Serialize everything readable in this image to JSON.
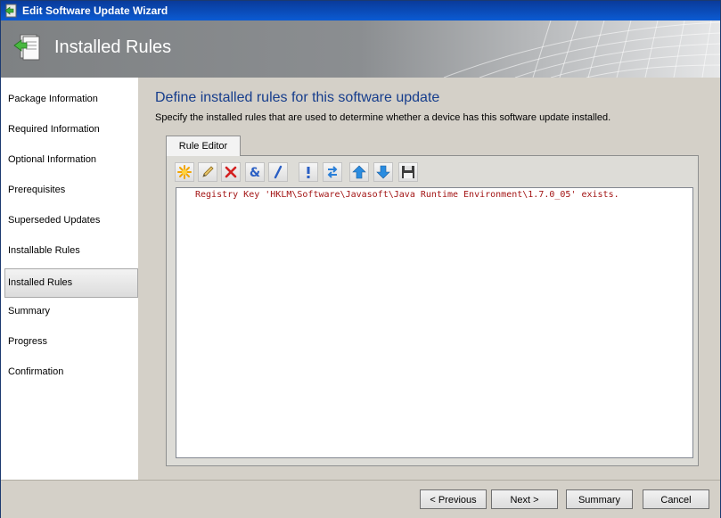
{
  "window": {
    "title": "Edit Software Update Wizard"
  },
  "banner": {
    "title": "Installed Rules"
  },
  "sidebar": {
    "items": [
      {
        "label": "Package Information",
        "active": false
      },
      {
        "label": "Required Information",
        "active": false
      },
      {
        "label": "Optional Information",
        "active": false
      },
      {
        "label": "Prerequisites",
        "active": false
      },
      {
        "label": "Superseded Updates",
        "active": false
      },
      {
        "label": "Installable Rules",
        "active": false
      },
      {
        "label": "Installed Rules",
        "active": true
      },
      {
        "label": "Summary",
        "active": false
      },
      {
        "label": "Progress",
        "active": false
      },
      {
        "label": "Confirmation",
        "active": false
      }
    ]
  },
  "main": {
    "heading": "Define installed rules for this software update",
    "description": "Specify the installed rules that are used to determine whether a device has this software update installed.",
    "tab_label": "Rule Editor",
    "toolbar_icons": [
      "new-rule-icon",
      "edit-pencil-icon",
      "delete-x-icon",
      "and-operator-icon",
      "or-operator-icon",
      "not-operator-icon",
      "toggle-operator-icon",
      "move-up-icon",
      "move-down-icon",
      "save-icon"
    ],
    "rule_text": "Registry Key 'HKLM\\Software\\Javasoft\\Java Runtime Environment\\1.7.0_05' exists."
  },
  "footer": {
    "previous_label": "< Previous",
    "next_label": "Next >",
    "summary_label": "Summary",
    "cancel_label": "Cancel"
  },
  "colors": {
    "title_bar": "#0b4fc0",
    "heading": "#163d8c",
    "rule_text": "#a31515"
  }
}
